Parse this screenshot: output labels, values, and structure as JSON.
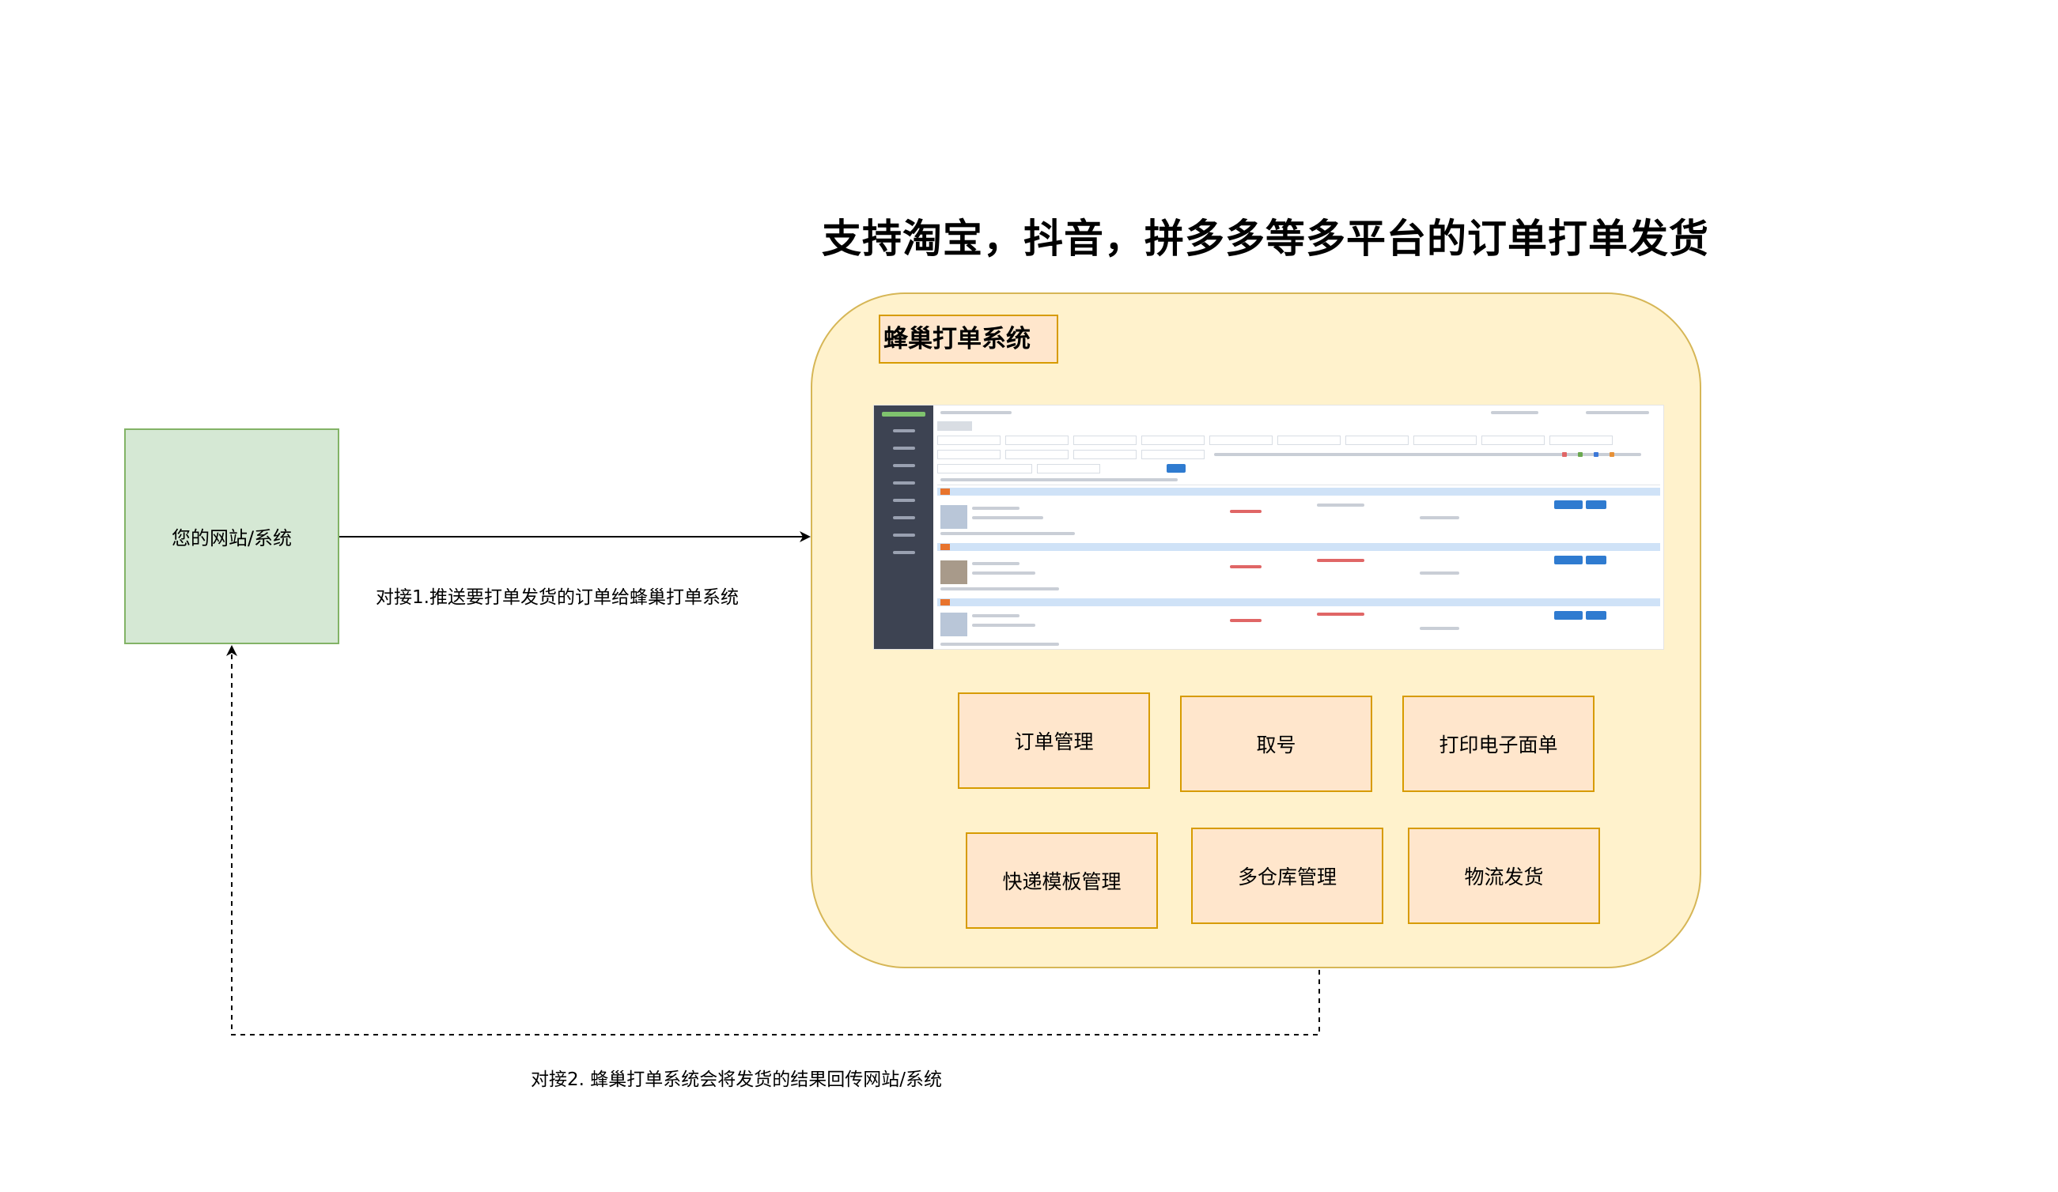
{
  "title": "支持淘宝，抖音，拼多多等多平台的订单打单发货",
  "site": {
    "label": "您的网站/系统"
  },
  "system": {
    "label": "蜂巢打单系统"
  },
  "edges": {
    "push_label": "对接1.推送要打单发货的订单给蜂巢打单系统",
    "callback_label": "对接2.  蜂巢打单系统会将发货的结果回传网站/系统"
  },
  "features": [
    {
      "label": "订单管理"
    },
    {
      "label": "取号"
    },
    {
      "label": "打印电子面单"
    },
    {
      "label": "快递模板管理"
    },
    {
      "label": "多仓库管理"
    },
    {
      "label": "物流发货"
    }
  ],
  "colors": {
    "container_fill": "#fff2cc",
    "container_stroke": "#d6b656",
    "feature_fill": "#ffe6cc",
    "feature_stroke": "#d79b00",
    "site_fill": "#d5e8d4",
    "site_stroke": "#82b366"
  }
}
